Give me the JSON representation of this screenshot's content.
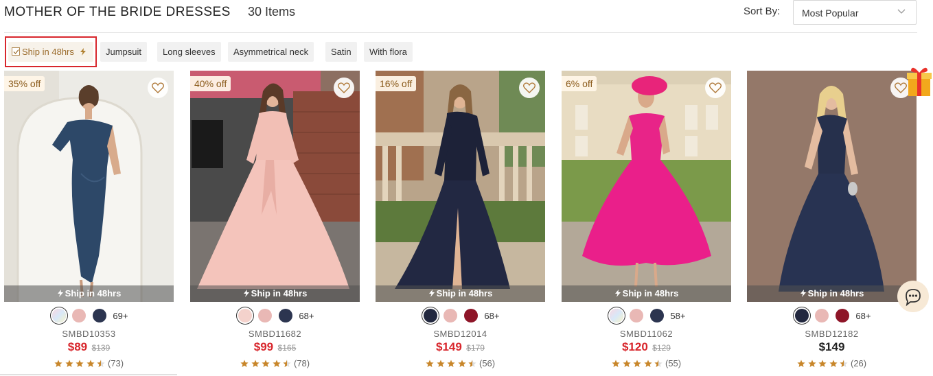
{
  "header": {
    "title": "MOTHER OF THE BRIDE DRESSES",
    "count": "30 Items",
    "sort_label": "Sort By:",
    "sort_value": "Most Popular"
  },
  "filters": [
    "Ship in 48hrs",
    "Jumpsuit",
    "Long sleeves",
    "Asymmetrical neck",
    "Satin",
    "With flora"
  ],
  "products": [
    {
      "discount": "35% off",
      "ship": "Ship in 48hrs",
      "colors": [
        "multi",
        "#e9b8b5",
        "#2c3550"
      ],
      "more": "69+",
      "sku": "SMBD10353",
      "price": "$89",
      "old_price": "$139",
      "reviews": "(73)"
    },
    {
      "discount": "40% off",
      "ship": "Ship in 48hrs",
      "colors": [
        "#f4d2cc",
        "#e9b8b5",
        "#2c3550"
      ],
      "more": "68+",
      "sku": "SMBD11682",
      "price": "$99",
      "old_price": "$165",
      "reviews": "(78)"
    },
    {
      "discount": "16% off",
      "ship": "Ship in 48hrs",
      "colors": [
        "#22283f",
        "#e9b8b5",
        "#8e1528"
      ],
      "more": "68+",
      "sku": "SMBD12014",
      "price": "$149",
      "old_price": "$179",
      "reviews": "(56)"
    },
    {
      "discount": "6% off",
      "ship": "Ship in 48hrs",
      "colors": [
        "multi",
        "#e9b8b5",
        "#2c3550"
      ],
      "more": "58+",
      "sku": "SMBD11062",
      "price": "$120",
      "old_price": "$129",
      "reviews": "(55)"
    },
    {
      "discount": "",
      "ship": "Ship in 48hrs",
      "colors": [
        "#22283f",
        "#e9b8b5",
        "#8e1528"
      ],
      "more": "68+",
      "sku": "SMBD12182",
      "price": "$149",
      "old_price": "",
      "reviews": "(26)"
    }
  ],
  "colors": {
    "accent": "#d8262c",
    "star": "#c8862a",
    "ship_text": "#9a6a2a"
  }
}
